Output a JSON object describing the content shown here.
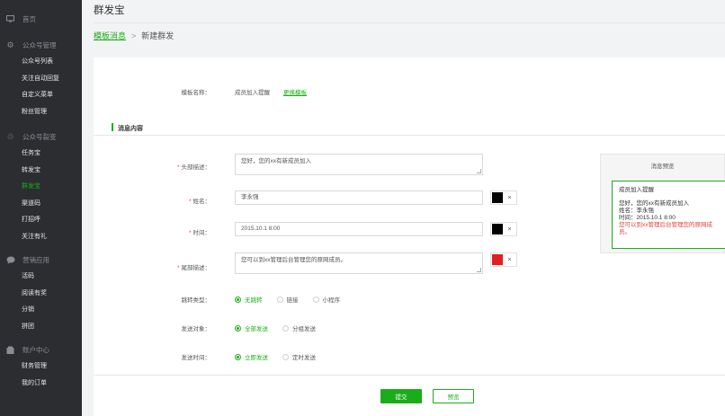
{
  "sidebar": {
    "groups": [
      {
        "label": "首页",
        "icon": "monitor-icon",
        "items": []
      },
      {
        "label": "公众号管理",
        "icon": "gear-icon",
        "items": [
          "公众号列表",
          "关注自动回复",
          "自定义菜单",
          "粉丝管理"
        ]
      },
      {
        "label": "公众号裂变",
        "icon": "recycle-icon",
        "items": [
          "任务宝",
          "转发宝",
          "群发宝",
          "渠道码",
          "打招呼",
          "关注有礼"
        ]
      },
      {
        "label": "营销应用",
        "icon": "chat-icon",
        "items": [
          "活码",
          "阅读有奖",
          "分销",
          "拼团"
        ]
      },
      {
        "label": "账户中心",
        "icon": "building-icon",
        "items": [
          "财务管理",
          "我的订单"
        ]
      }
    ],
    "active_item": "群发宝"
  },
  "page": {
    "title": "群发宝",
    "breadcrumb": {
      "link": "模板消息",
      "separator": ">",
      "current": "新建群发"
    }
  },
  "form": {
    "template_label": "模板名称：",
    "template_name": "成员加入提醒",
    "change_template": "更换模板",
    "section_title": "消息内容",
    "header": {
      "label": "头部描述：",
      "value": "您好，您的xx有新成员加入"
    },
    "name": {
      "label": "姓名：",
      "value": "李永强"
    },
    "time": {
      "label": "时间：",
      "value": "2015.10.1 8:00"
    },
    "footer": {
      "label": "尾部描述：",
      "value": "您可以到xx管理后台管理您的原网成员。"
    },
    "jump_type": {
      "label": "跳转类型：",
      "options": [
        "无跳转",
        "链接",
        "小程序"
      ],
      "selected": "无跳转"
    },
    "send_target": {
      "label": "发送对象：",
      "options": [
        "全部发送",
        "分组发送"
      ],
      "selected": "全部发送"
    },
    "send_time": {
      "label": "发送时间：",
      "options": [
        "立即发送",
        "定时发送"
      ],
      "selected": "立即发送"
    },
    "color_clear": "×",
    "colors": {
      "header": "#000000",
      "name": "#000000",
      "time": "#000000",
      "footer": "#e02020"
    },
    "submit": "提交",
    "preview": "预览"
  },
  "preview": {
    "title": "消息预览",
    "card_title": "成员加入提醒",
    "line1": "您好，您的xx有新成员加入",
    "line2": "姓名：李永强",
    "line3": "时间：2015.10.1 8:00",
    "line4": "您可以到xx管理后台管理您的原网成员。"
  },
  "theme": {
    "accent": "#1aad19",
    "sidebar_bg": "#2b2d31"
  }
}
